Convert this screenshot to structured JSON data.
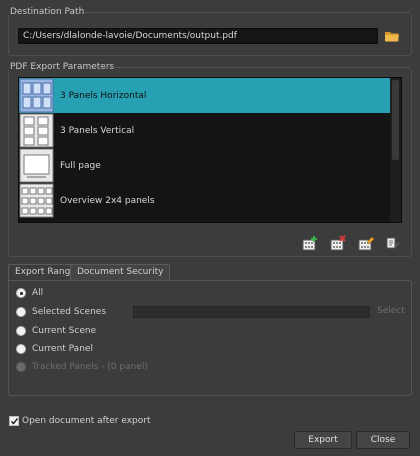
{
  "destination": {
    "title": "Destination Path",
    "path_value": "C:/Users/dlalonde-lavoie/Documents/output.pdf"
  },
  "parameters": {
    "title": "PDF Export Parameters",
    "items": [
      {
        "label": "3 Panels Horizontal",
        "selected": true
      },
      {
        "label": "3 Panels Vertical",
        "selected": false
      },
      {
        "label": "Full page",
        "selected": false
      },
      {
        "label": "Overview 2x4 panels",
        "selected": false
      }
    ],
    "toolbar_icons": [
      "add-layout-icon",
      "delete-layout-icon",
      "rename-layout-icon",
      "edit-layout-icon"
    ]
  },
  "tabs": [
    {
      "label": "Export Range",
      "active": true
    },
    {
      "label": "Document Security",
      "active": false
    }
  ],
  "export_range": {
    "options": [
      {
        "label": "All",
        "checked": true,
        "disabled": false
      },
      {
        "label": "Selected Scenes",
        "checked": false,
        "disabled": false
      },
      {
        "label": "Current Scene",
        "checked": false,
        "disabled": false
      },
      {
        "label": "Current Panel",
        "checked": false,
        "disabled": false
      },
      {
        "label": "Tracked Panels - (0 panel)",
        "checked": false,
        "disabled": true
      }
    ],
    "scenes_value": "",
    "select_label": "Select"
  },
  "footer": {
    "open_after_export_label": "Open document after export",
    "open_after_export_checked": true,
    "export_label": "Export",
    "close_label": "Close"
  },
  "colors": {
    "selection": "#28a0b3",
    "background": "#3c3c3c"
  }
}
